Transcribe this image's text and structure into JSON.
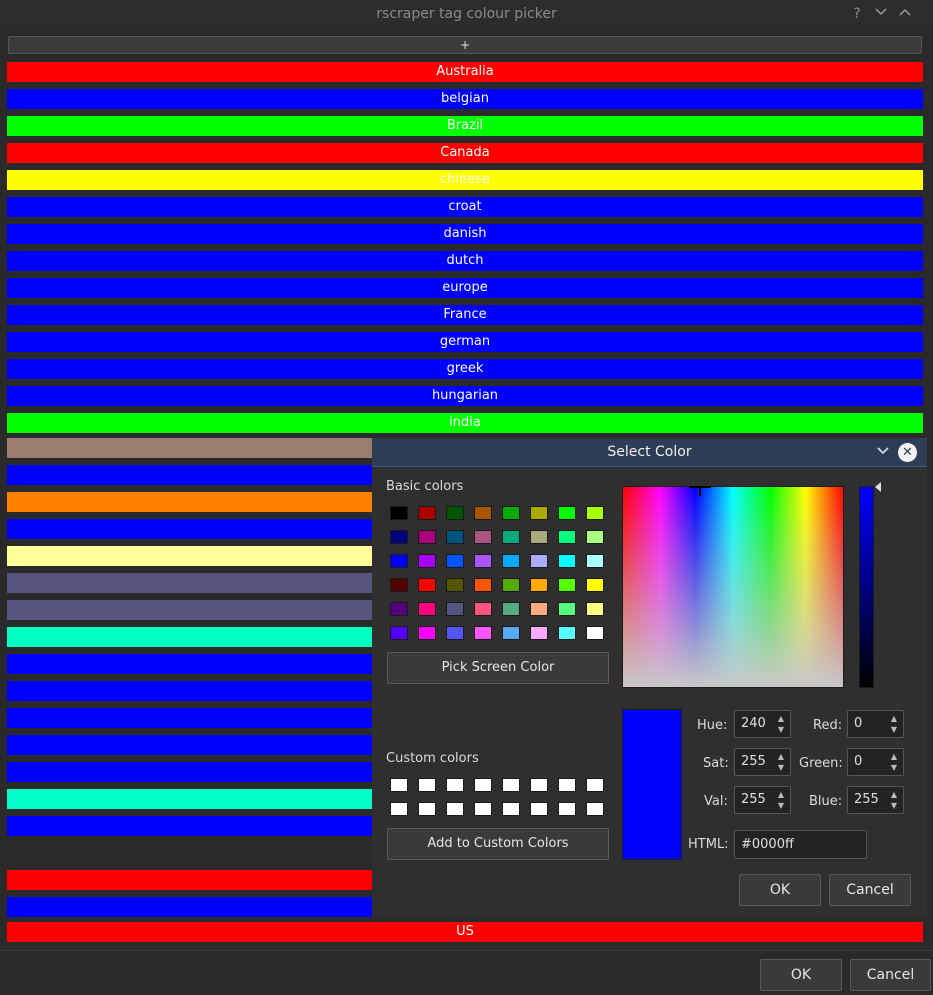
{
  "window": {
    "title": "rscraper tag colour picker",
    "help_icon": "?",
    "minimize_icon": "⌄",
    "maximize_icon": "⌃"
  },
  "add_button": "+",
  "rows": [
    {
      "label": "Australia",
      "color": "#ff0000"
    },
    {
      "label": "belgian",
      "color": "#0000ff"
    },
    {
      "label": "Brazil",
      "color": "#00ff00"
    },
    {
      "label": "Canada",
      "color": "#ff0000"
    },
    {
      "label": "chinese",
      "color": "#ffff00"
    },
    {
      "label": "croat",
      "color": "#0000ff"
    },
    {
      "label": "danish",
      "color": "#0000ff"
    },
    {
      "label": "dutch",
      "color": "#0000ff"
    },
    {
      "label": "europe",
      "color": "#0000ff"
    },
    {
      "label": "France",
      "color": "#0000ff"
    },
    {
      "label": "german",
      "color": "#0000ff"
    },
    {
      "label": "greek",
      "color": "#0000ff"
    },
    {
      "label": "hungarian",
      "color": "#0000ff"
    },
    {
      "label": "india",
      "color": "#00ff00"
    }
  ],
  "partial_rows": [
    {
      "color": "#9b7d70"
    },
    {
      "color": "#0000ff"
    },
    {
      "color": "#ff8000"
    },
    {
      "color": "#0000ff"
    },
    {
      "color": "#ffff99"
    },
    {
      "color": "#55557f"
    },
    {
      "color": "#55557f"
    },
    {
      "color": "#00ffc0"
    },
    {
      "color": "#0000ff"
    },
    {
      "color": "#0000ff"
    },
    {
      "color": "#0000ff"
    },
    {
      "color": "#0000ff"
    },
    {
      "color": "#0000ff"
    },
    {
      "color": "#00ffc8"
    },
    {
      "color": "#0000ff"
    },
    {
      "color": "#2a2a2a"
    },
    {
      "color": "#ff0000"
    },
    {
      "color": "#0000ff"
    }
  ],
  "last_row": {
    "label": "US",
    "color": "#ff0000"
  },
  "footer": {
    "ok": "OK",
    "cancel": "Cancel"
  },
  "dialog": {
    "title": "Select Color",
    "basic_colors_label": "Basic colors",
    "basic_colors": [
      [
        "#000000",
        "#aa0000",
        "#005500",
        "#aa5500",
        "#00aa00",
        "#aaaa00",
        "#00ff00",
        "#aaff00"
      ],
      [
        "#00007f",
        "#aa007f",
        "#00557f",
        "#aa557f",
        "#00aa7f",
        "#aaaa7f",
        "#00ff7f",
        "#aaff7f"
      ],
      [
        "#0000ff",
        "#aa00ff",
        "#0055ff",
        "#aa55ff",
        "#00aaff",
        "#aaaaff",
        "#00ffff",
        "#aaffff"
      ],
      [
        "#550000",
        "#ff0000",
        "#555500",
        "#ff5500",
        "#55aa00",
        "#ffaa00",
        "#55ff00",
        "#ffff00"
      ],
      [
        "#55007f",
        "#ff007f",
        "#55557f",
        "#ff557f",
        "#55aa7f",
        "#ffaa7f",
        "#55ff7f",
        "#ffff7f"
      ],
      [
        "#5500ff",
        "#ff00ff",
        "#5555ff",
        "#ff55ff",
        "#55aaff",
        "#ffaaff",
        "#55ffff",
        "#ffffff"
      ]
    ],
    "pick_screen_color": "Pick Screen Color",
    "custom_colors_label": "Custom colors",
    "add_custom": "Add to Custom Colors",
    "current_color": "#0000ff",
    "fields": {
      "hue_label": "Hue:",
      "hue": "240",
      "sat_label": "Sat:",
      "sat": "255",
      "val_label": "Val:",
      "val": "255",
      "red_label": "Red:",
      "red": "0",
      "green_label": "Green:",
      "green": "0",
      "blue_label": "Blue:",
      "blue": "255",
      "html_label": "HTML:",
      "html": "#0000ff"
    },
    "ok": "OK",
    "cancel": "Cancel"
  }
}
